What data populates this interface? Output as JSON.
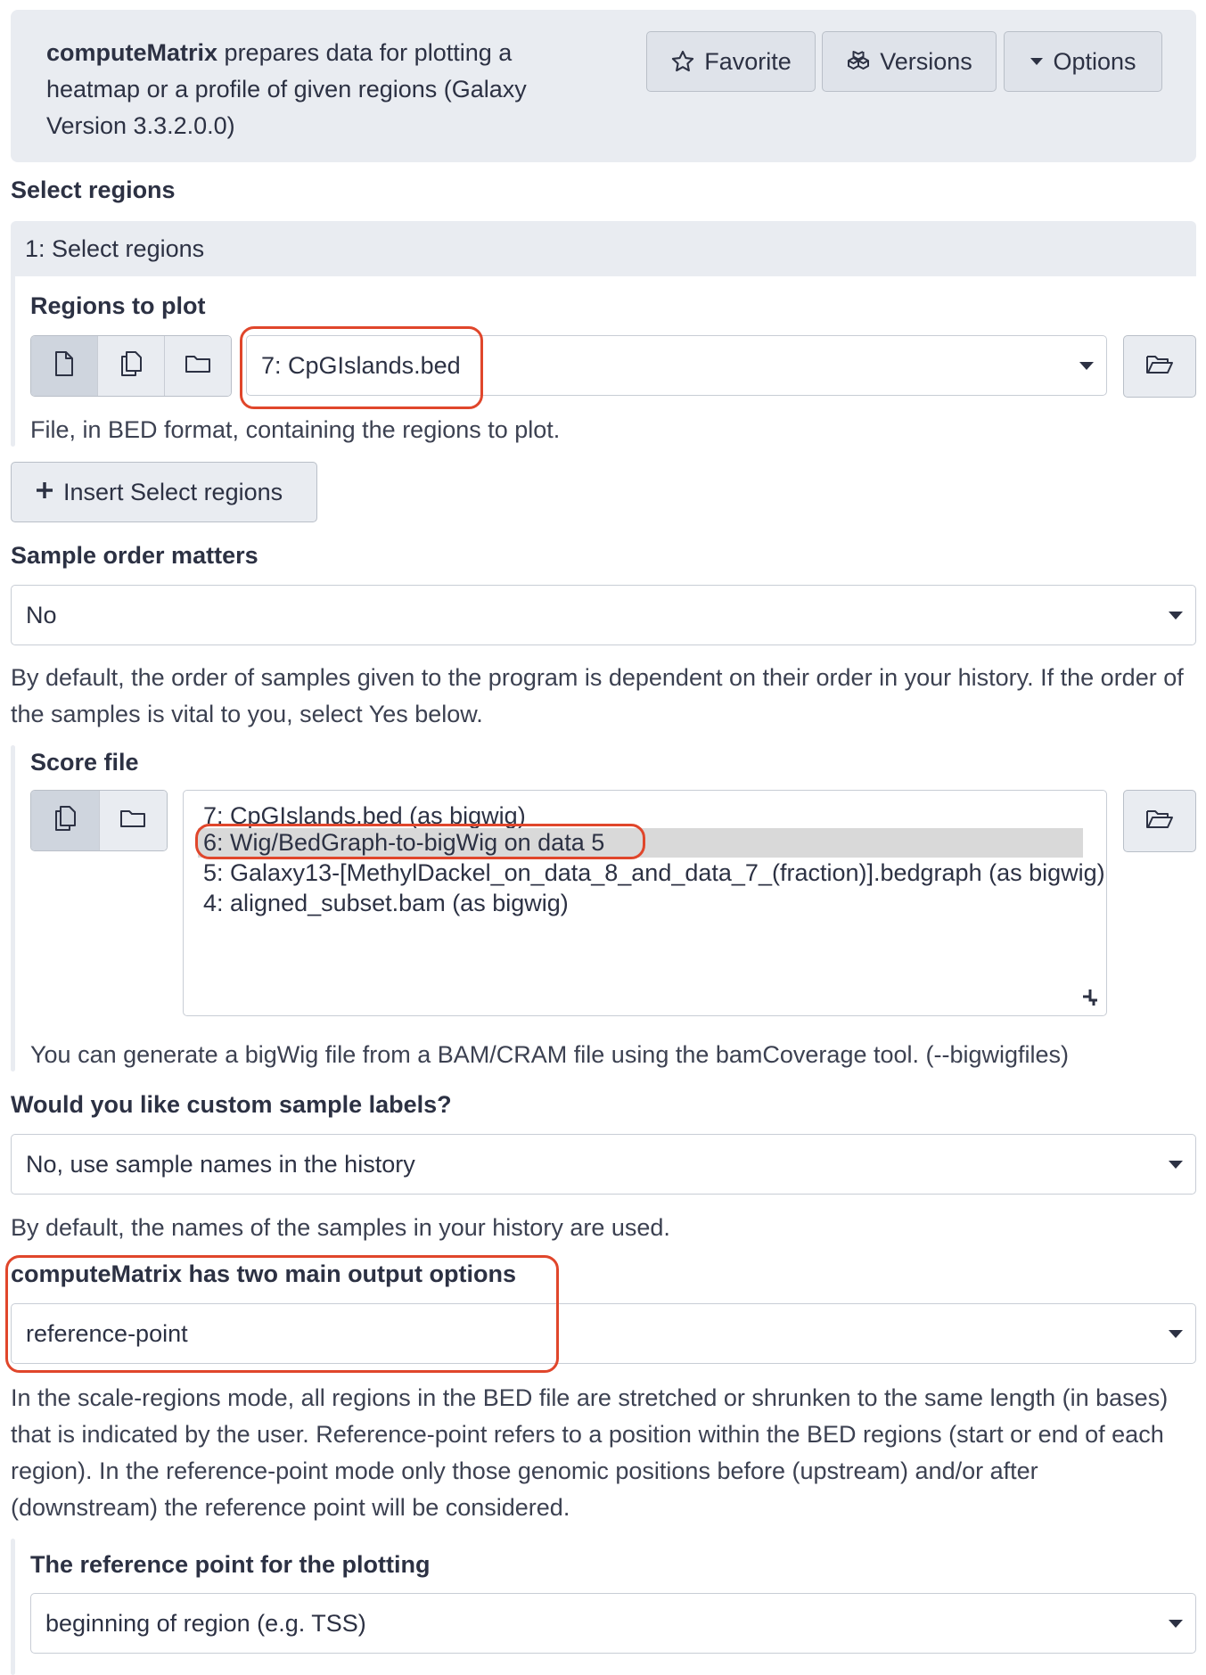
{
  "header": {
    "tool_name": "computeMatrix",
    "description": " prepares data for plotting a heatmap or a profile of given regions (Galaxy Version 3.3.2.0.0)",
    "buttons": {
      "favorite": "Favorite",
      "versions": "Versions",
      "options": "Options"
    }
  },
  "select_regions": {
    "title": "Select regions",
    "repeat_title": "1: Select regions",
    "label": "Regions to plot",
    "value": "7: CpGIslands.bed",
    "help": "File, in BED format, containing the regions to plot.",
    "insert_label": "Insert Select regions"
  },
  "sample_order": {
    "label": "Sample order matters",
    "value": "No",
    "help": "By default, the order of samples given to the program is dependent on their order in your history. If the order of the samples is vital to you, select Yes below."
  },
  "score_file": {
    "label": "Score file",
    "options": [
      "7: CpGIslands.bed (as bigwig)",
      "6: Wig/BedGraph-to-bigWig on data 5",
      "5: Galaxy13-[MethylDackel_on_data_8_and_data_7_(fraction)].bedgraph (as bigwig)",
      "4: aligned_subset.bam (as bigwig)"
    ],
    "selected_index": 1,
    "help": "You can generate a bigWig file from a BAM/CRAM file using the bamCoverage tool. (--bigwigfiles)"
  },
  "custom_labels": {
    "label": "Would you like custom sample labels?",
    "value": "No, use sample names in the history",
    "help": "By default, the names of the samples in your history are used."
  },
  "output_mode": {
    "label": "computeMatrix has two main output options",
    "value": "reference-point",
    "help": "In the scale-regions mode, all regions in the BED file are stretched or shrunken to the same length (in bases) that is indicated by the user. Reference-point refers to a position within the BED regions (start or end of each region). In the reference-point mode only those genomic positions before (upstream) and/or after (downstream) the reference point will be considered."
  },
  "reference_point": {
    "label": "The reference point for the plotting",
    "value": "beginning of region (e.g. TSS)"
  },
  "colors": {
    "annotation": "#e0462b",
    "panel": "#e9ecf1",
    "text": "#2c3143"
  }
}
